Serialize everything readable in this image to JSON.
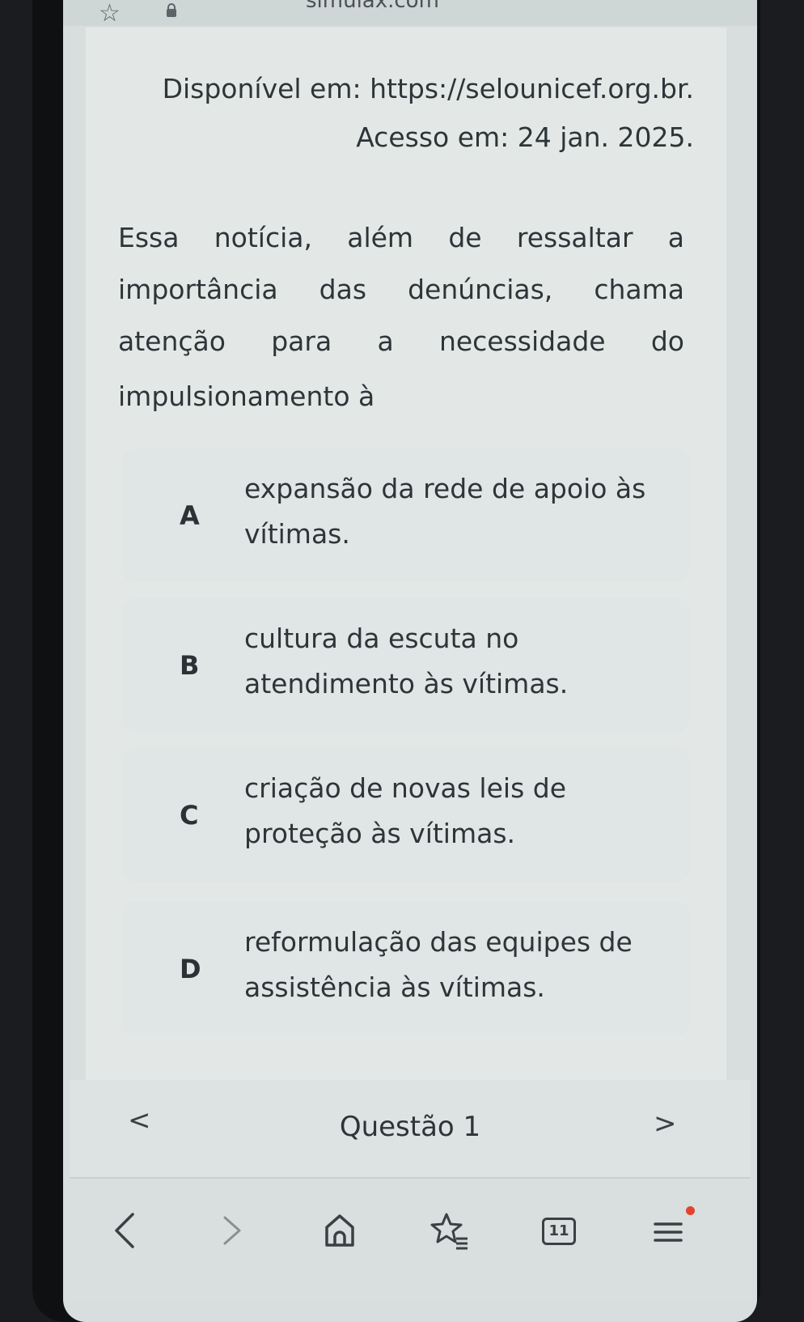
{
  "browser": {
    "url_fragment": "simulax.com"
  },
  "source": {
    "available_at": "Disponível em: https://selounicef.org.br.",
    "accessed_on": "Acesso em: 24 jan. 2025."
  },
  "question": {
    "lines": [
      "Essa notícia, além de ressaltar a",
      "importância das denúncias, chama",
      "atenção para a necessidade do",
      "impulsionamento à"
    ]
  },
  "options": [
    {
      "letter": "A",
      "text": "expansão da rede de apoio às vítimas."
    },
    {
      "letter": "B",
      "text": "cultura da escuta no atendimento às vítimas."
    },
    {
      "letter": "C",
      "text": "criação de novas leis de proteção às vítimas."
    },
    {
      "letter": "D",
      "text": "reformulação das equipes de assistência às vítimas."
    }
  ],
  "question_nav": {
    "prev": "<",
    "label": "Questão 1",
    "next": ">"
  },
  "bottom_bar": {
    "tab_count": "11",
    "icons": [
      "back-arrow-icon",
      "forward-arrow-icon",
      "home-icon",
      "bookmarks-icon",
      "tabs-icon",
      "menu-icon"
    ],
    "notification_color": "#e2452f"
  }
}
